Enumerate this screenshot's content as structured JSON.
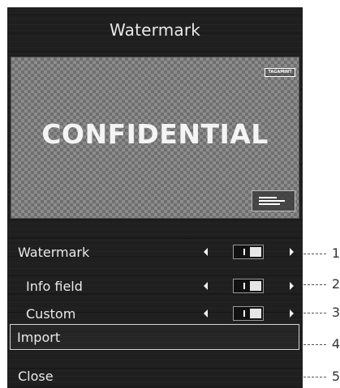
{
  "dialog": {
    "title": "Watermark",
    "preview": {
      "watermark_text": "CONFIDENTIAL",
      "tag_text": "TAGAMINT",
      "icon": "info-field-icon"
    }
  },
  "rows": [
    {
      "label": "Watermark",
      "callout": "1",
      "toggle_state": "on"
    },
    {
      "label": "Info field",
      "callout": "2",
      "toggle_state": "on"
    },
    {
      "label": "Custom",
      "callout": "3",
      "toggle_state": "on"
    }
  ],
  "import": {
    "label": "Import",
    "callout": "4"
  },
  "close": {
    "label": "Close",
    "callout": "5"
  },
  "colors": {
    "panel_bg": "#1f1f1f",
    "text": "#eaeaea",
    "highlight_border": "#d4d4d4"
  }
}
